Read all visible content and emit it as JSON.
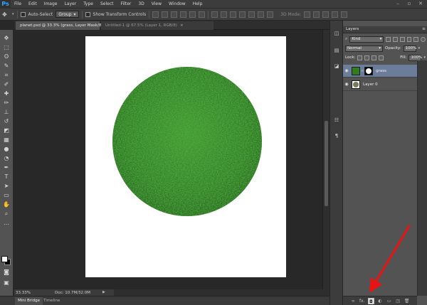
{
  "app": {
    "logo": "Ps",
    "brand_color": "#31a8ff",
    "menu": [
      "File",
      "Edit",
      "Image",
      "Layer",
      "Type",
      "Select",
      "Filter",
      "3D",
      "View",
      "Window",
      "Help"
    ]
  },
  "options_bar": {
    "auto_select_label": "Auto-Select",
    "group_value": "Group",
    "show_transform_label": "Show Transform Controls",
    "mode_3d_label": "3D Mode:"
  },
  "documents": {
    "tabs": [
      {
        "label": "planet.psd @ 33.3% (grass, Layer Mask/8)",
        "active": true
      },
      {
        "label": "Untitled-1 @ 67.5% (Layer 1, RGB/8)",
        "active": false
      }
    ]
  },
  "status": {
    "zoom": "33.33%",
    "doc": "Doc: 10.7M/32.0M"
  },
  "bottom_tabs": [
    "Mini Bridge",
    "Timeline"
  ],
  "layers_panel": {
    "title": "Layers",
    "filter_kind": "Kind",
    "blend_mode": "Normal",
    "opacity_label": "Opacity:",
    "opacity_value": "100%",
    "lock_label": "Lock:",
    "fill_label": "Fill:",
    "fill_value": "100%",
    "layers": [
      {
        "name": "grass",
        "selected": true,
        "has_mask": true
      },
      {
        "name": "Layer 0",
        "selected": false,
        "has_mask": false
      }
    ],
    "bottom_icons": [
      "link-icon",
      "fx-icon",
      "layer-mask-icon",
      "adjustment-icon",
      "group-icon",
      "new-layer-icon",
      "trash-icon"
    ],
    "bottom_fx": "fx."
  },
  "colors": {
    "canvas_bg": "#ffffff",
    "grass": "#2d7a1f",
    "selected_layer": "#6c7d9c",
    "annotation_arrow": "#e81414"
  }
}
